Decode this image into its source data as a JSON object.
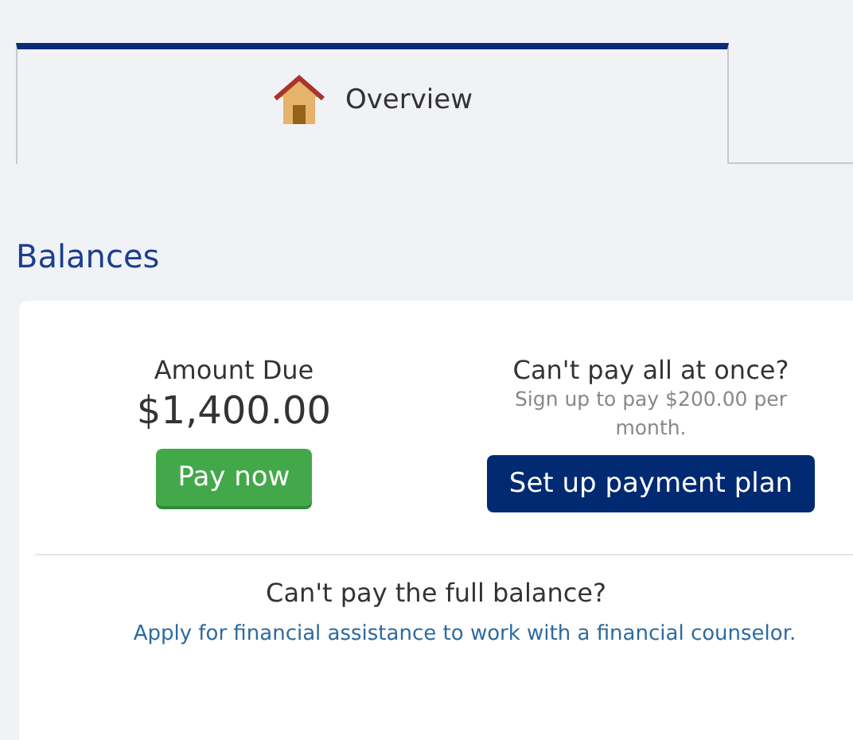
{
  "tabs": [
    {
      "label": "Overview",
      "selected": true
    }
  ],
  "section_title": "Balances",
  "balance": {
    "label": "Amount Due",
    "amount": "$1,400.00",
    "pay_button": "Pay now"
  },
  "plan": {
    "title": "Can't pay all at once?",
    "subtitle": "Sign up to pay $200.00 per month.",
    "button": "Set up payment plan"
  },
  "assistance": {
    "title": "Can't pay the full balance?",
    "link": "Apply for financial assistance to work with a financial counselor."
  }
}
